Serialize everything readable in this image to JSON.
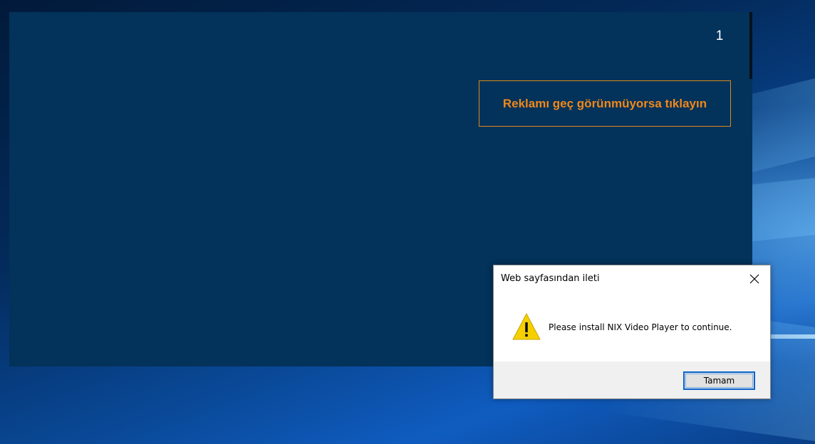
{
  "ad": {
    "counter": "1",
    "skip_label": "Reklamı geç görünmüyorsa tıklayın"
  },
  "dialog": {
    "title": "Web sayfasından ileti",
    "message": "Please install NIX Video Player to continue.",
    "ok_label": "Tamam",
    "icon": "warning-icon",
    "close_icon": "close-icon"
  },
  "colors": {
    "ad_background": "#03325a",
    "skip_accent": "#f0881a",
    "ok_border": "#0a64c8",
    "warning_yellow": "#f5d000"
  }
}
